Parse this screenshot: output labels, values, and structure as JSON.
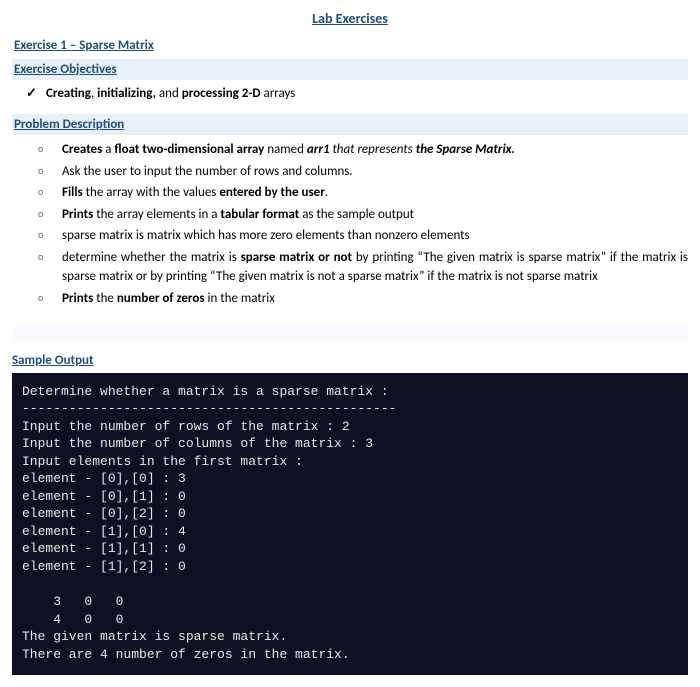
{
  "title": "Lab Exercises",
  "exercise_heading": "Exercise 1 – Sparse Matrix",
  "objectives_heading": "Exercise Objectives",
  "objective_line": "Creating, initializing, and processing 2-D arrays",
  "problem_heading": "Problem Description",
  "items": [
    {
      "html": "<b>Creates</b> a <b>float two-dimensional array</b> named <b><i>arr1</i></b> <i>that represents</i> <b><i>the Sparse Matrix.</i></b>"
    },
    {
      "html": "Ask the user to input the number of rows and columns."
    },
    {
      "html": "<b>Fills</b> the array with the values <b>entered by the user</b>."
    },
    {
      "html": "<b>Prints</b> the array elements in a <b>tabular format</b> as the sample output"
    },
    {
      "html": "sparse matrix is matrix which has more zero elements than nonzero elements"
    },
    {
      "html": "determine whether the matrix is <b>sparse matrix or not</b> by printing “The given matrix is sparse matrix” if the matrix is sparse matrix or by printing “The given matrix is not a sparse matrix” if the matrix is not sparse matrix"
    },
    {
      "html": "<b>Prints</b> the <b>number of zeros</b> in the matrix"
    }
  ],
  "sample_heading": "Sample Output",
  "terminal_text": "Determine whether a matrix is a sparse matrix :\n------------------------------------------------\nInput the number of rows of the matrix : 2\nInput the number of columns of the matrix : 3\nInput elements in the first matrix :\nelement - [0],[0] : 3\nelement - [0],[1] : 0\nelement - [0],[2] : 0\nelement - [1],[0] : 4\nelement - [1],[1] : 0\nelement - [1],[2] : 0\n\n    3   0   0\n    4   0   0\nThe given matrix is sparse matrix.\nThere are 4 number of zeros in the matrix."
}
